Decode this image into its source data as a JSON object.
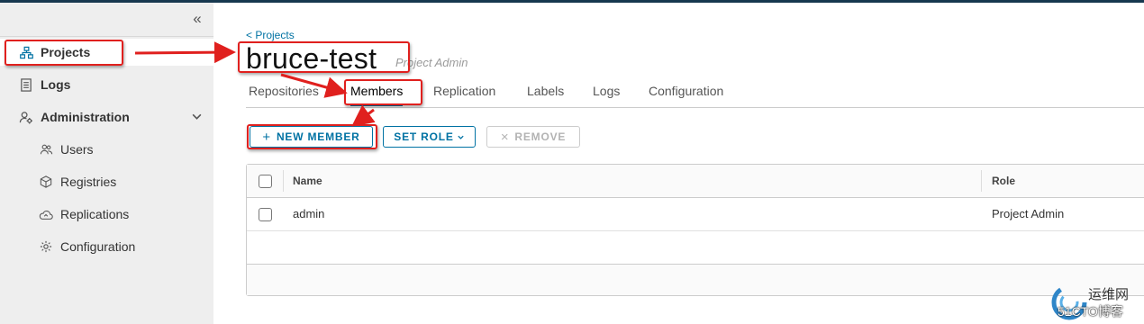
{
  "sidebar": {
    "collapse_glyph": "«",
    "items": [
      {
        "label": "Projects",
        "icon": "org-chart-icon"
      },
      {
        "label": "Logs",
        "icon": "document-icon"
      },
      {
        "label": "Administration",
        "icon": "users-cog-icon"
      },
      {
        "label": "Users",
        "icon": "users-icon"
      },
      {
        "label": "Registries",
        "icon": "box-icon"
      },
      {
        "label": "Replications",
        "icon": "cloud-sync-icon"
      },
      {
        "label": "Configuration",
        "icon": "gear-icon"
      }
    ]
  },
  "main": {
    "breadcrumb": "< Projects",
    "title": "bruce-test",
    "role_tag": "Project Admin",
    "tabs": [
      {
        "label": "Repositories"
      },
      {
        "label": "Members"
      },
      {
        "label": "Replication"
      },
      {
        "label": "Labels"
      },
      {
        "label": "Logs"
      },
      {
        "label": "Configuration"
      }
    ],
    "active_tab": "Members",
    "buttons": {
      "new_member": "NEW MEMBER",
      "set_role": "SET ROLE",
      "remove": "REMOVE"
    },
    "table": {
      "columns": [
        "Name",
        "Role"
      ],
      "rows": [
        {
          "name": "admin",
          "role": "Project Admin"
        }
      ]
    }
  },
  "watermark": {
    "line1": "运维网",
    "line2": "51CTO博客"
  },
  "colors": {
    "accent": "#0072a3",
    "annotation": "#e0201e",
    "sidebar_bg": "#eeeeee",
    "topbar": "#17384f"
  }
}
